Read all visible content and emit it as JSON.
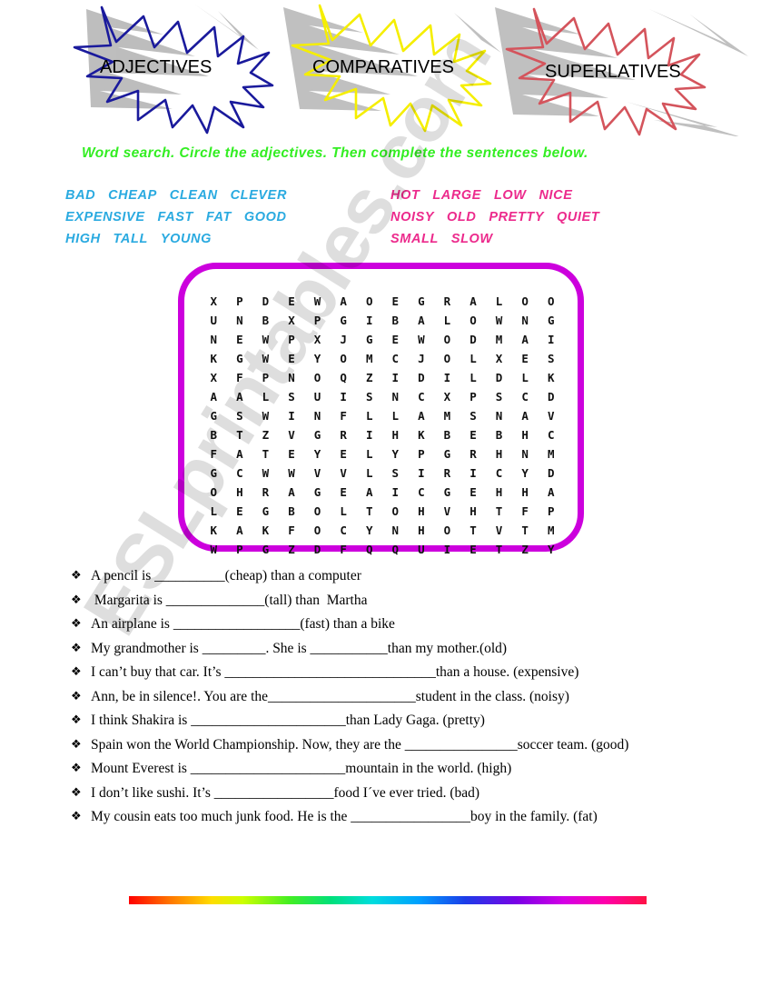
{
  "banner": {
    "bursts": [
      {
        "label": "ADJECTIVES",
        "color": "#1a1a9c"
      },
      {
        "label": "COMPARATIVES",
        "color": "#f5ee00"
      },
      {
        "label": "SUPERLATIVES",
        "color": "#d4545c"
      }
    ]
  },
  "instruction": {
    "text": "Word search. Circle the adjectives. Then complete the sentences below.",
    "color": "#33ee22"
  },
  "wordlist": {
    "left_color": "#2aaae0",
    "right_color": "#ec2a8c",
    "left_rows": [
      [
        "BAD",
        "CHEAP",
        "CLEAN",
        "CLEVER"
      ],
      [
        "EXPENSIVE",
        "FAST",
        "FAT",
        "GOOD"
      ],
      [
        "HIGH",
        "TALL",
        "YOUNG"
      ]
    ],
    "right_rows": [
      [
        "HOT",
        "LARGE",
        "LOW",
        "NICE"
      ],
      [
        "NOISY",
        "OLD",
        "PRETTY",
        "QUIET"
      ],
      [
        "SMALL",
        "SLOW"
      ]
    ]
  },
  "wordsearch": {
    "border_color": "#cc00dd",
    "rows": 14,
    "cols": 14,
    "grid": [
      [
        "X",
        "P",
        "D",
        "E",
        "W",
        "A",
        "O",
        "E",
        "G",
        "R",
        "A",
        "L",
        "O",
        "O"
      ],
      [
        "U",
        "N",
        "B",
        "X",
        "P",
        "G",
        "I",
        "B",
        "A",
        "L",
        "O",
        "W",
        "N",
        "G"
      ],
      [
        "N",
        "E",
        "W",
        "P",
        "X",
        "J",
        "G",
        "E",
        "W",
        "O",
        "D",
        "M",
        "A",
        "I"
      ],
      [
        "K",
        "G",
        "W",
        "E",
        "Y",
        "O",
        "M",
        "C",
        "J",
        "O",
        "L",
        "X",
        "E",
        "S"
      ],
      [
        "X",
        "F",
        "P",
        "N",
        "O",
        "Q",
        "Z",
        "I",
        "D",
        "I",
        "L",
        "D",
        "L",
        "K"
      ],
      [
        "A",
        "A",
        "L",
        "S",
        "U",
        "I",
        "S",
        "N",
        "C",
        "X",
        "P",
        "S",
        "C",
        "D"
      ],
      [
        "G",
        "S",
        "W",
        "I",
        "N",
        "F",
        "L",
        "L",
        "A",
        "M",
        "S",
        "N",
        "A",
        "V"
      ],
      [
        "B",
        "T",
        "Z",
        "V",
        "G",
        "R",
        "I",
        "H",
        "K",
        "B",
        "E",
        "B",
        "H",
        "C"
      ],
      [
        "F",
        "A",
        "T",
        "E",
        "Y",
        "E",
        "L",
        "Y",
        "P",
        "G",
        "R",
        "H",
        "N",
        "M"
      ],
      [
        "G",
        "C",
        "W",
        "W",
        "V",
        "V",
        "L",
        "S",
        "I",
        "R",
        "I",
        "C",
        "Y",
        "D"
      ],
      [
        "O",
        "H",
        "R",
        "A",
        "G",
        "E",
        "A",
        "I",
        "C",
        "G",
        "E",
        "H",
        "H",
        "A"
      ],
      [
        "L",
        "E",
        "G",
        "B",
        "O",
        "L",
        "T",
        "O",
        "H",
        "V",
        "H",
        "T",
        "F",
        "P"
      ],
      [
        "K",
        "A",
        "K",
        "F",
        "O",
        "C",
        "Y",
        "N",
        "H",
        "O",
        "T",
        "V",
        "T",
        "M"
      ],
      [
        "W",
        "P",
        "G",
        "Z",
        "D",
        "F",
        "Q",
        "Q",
        "U",
        "I",
        "E",
        "T",
        "Z",
        "Y"
      ]
    ]
  },
  "exercises": {
    "bullet": "❖",
    "items": [
      {
        "text": "A pencil is __________(cheap) than a computer"
      },
      {
        "text": " Margarita is ______________(tall) than  Martha"
      },
      {
        "text": "An airplane is __________________(fast) than a bike"
      },
      {
        "text": "My grandmother is _________. She is ___________than my mother.(old)"
      },
      {
        "text": "I can’t buy that car. It’s ______________________________than a house. (expensive)"
      },
      {
        "text": "Ann, be in silence!. You are the_____________________student in the class. (noisy)"
      },
      {
        "text": "I think Shakira is ______________________than Lady Gaga. (pretty)"
      },
      {
        "text": "Spain won the World Championship. Now, they are the ________________soccer team. (good)"
      },
      {
        "text": "Mount Everest is ______________________mountain in the world. (high)"
      },
      {
        "text": "I don’t like sushi. It’s _________________food I´ve ever tried. (bad)"
      },
      {
        "text": "My cousin eats too much junk food. He is the _________________boy in the family. (fat)"
      }
    ]
  },
  "watermark": {
    "text": "ESLprintables.com"
  },
  "footer": {
    "rainbow_label": "rainbow-divider"
  }
}
